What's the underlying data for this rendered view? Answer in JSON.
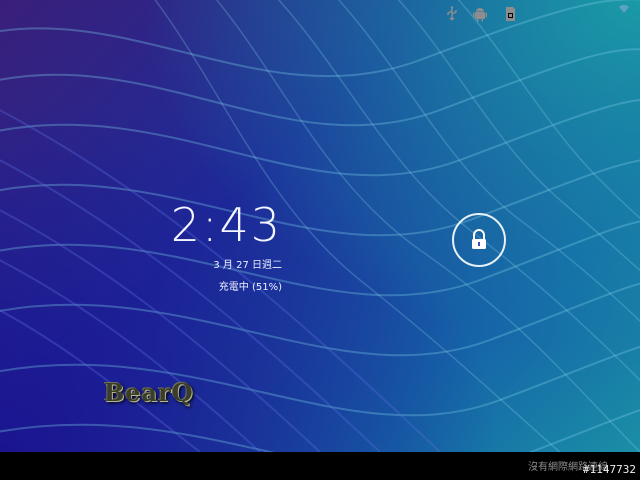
{
  "lockscreen": {
    "time": "2:43",
    "date": "3 月 27 日週二",
    "charging": "充電中 (51%)"
  },
  "watermark": {
    "text": "BearQ"
  },
  "statusbar": {
    "network_status": "沒有網際網路連線",
    "post_id": "#1147732",
    "icons": [
      "usb-icon",
      "android-debug-icon",
      "sd-card-icon",
      "wifi-icon"
    ]
  },
  "colors": {
    "wallpaper_purple": "#3a1f7a",
    "wallpaper_blue": "#1d2c9a",
    "wallpaper_teal": "#1a8fa6",
    "nav_bg": "#000000"
  }
}
